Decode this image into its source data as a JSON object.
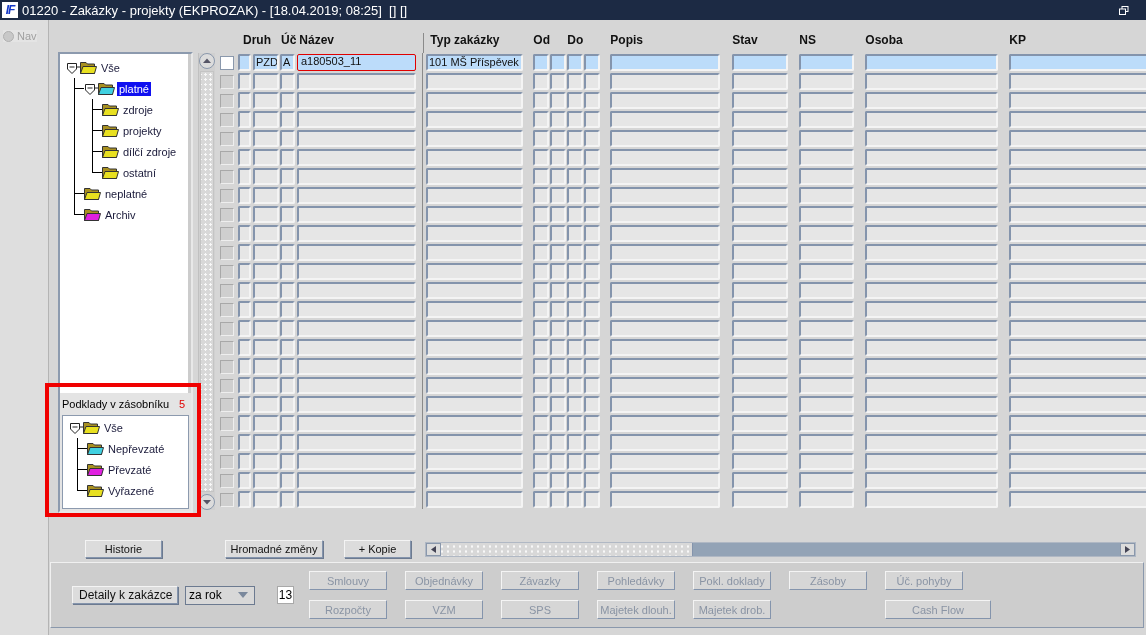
{
  "window": {
    "logo": "IF",
    "title": "01220 - Zakázky - projekty (EKPROZAK) - [18.04.2019; 08:25]  [] []"
  },
  "nav": {
    "label": "Nav",
    "disabled": true
  },
  "tree": [
    {
      "label": "Vše",
      "color": "#e8e020",
      "expanded": true,
      "selected": false,
      "children": [
        {
          "label": "platné",
          "color": "#40d0e0",
          "expanded": true,
          "selected": true,
          "children": [
            {
              "label": "zdroje",
              "color": "#e8e020",
              "selected": false
            },
            {
              "label": "projekty",
              "color": "#e8e020",
              "selected": false
            },
            {
              "label": "dílčí zdroje",
              "color": "#e8e020",
              "selected": false
            },
            {
              "label": "ostatní",
              "color": "#e8e020",
              "selected": false
            }
          ]
        },
        {
          "label": "neplatné",
          "color": "#e8e020",
          "selected": false
        },
        {
          "label": "Archiv",
          "color": "#e020e0",
          "selected": false
        }
      ]
    }
  ],
  "podklady": {
    "label": "Podklady v zásobníku",
    "count": "5",
    "highlighted": true,
    "tree": [
      {
        "label": "Vše",
        "color": "#e8e020",
        "expanded": true,
        "selected": false,
        "children": [
          {
            "label": "Nepřevzaté",
            "color": "#40d0e0",
            "selected": false
          },
          {
            "label": "Převzaté",
            "color": "#e020e0",
            "selected": false
          },
          {
            "label": "Vyřazené",
            "color": "#e8e020",
            "selected": false
          }
        ]
      }
    ]
  },
  "table": {
    "columns": [
      "Druh",
      "Úč",
      "Název",
      "Typ zakázky",
      "Od",
      "Do",
      "Popis",
      "Stav",
      "NS",
      "Osoba",
      "KP"
    ],
    "rows": [
      {
        "selected": true,
        "focused": true,
        "checked": false,
        "druh": "PZD",
        "uc": "A",
        "nazev": "a180503_11",
        "typ_zakazky": "101 MŠ Příspěvek"
      },
      {
        "selected": false,
        "focused": false,
        "checked": false
      },
      {
        "selected": false,
        "focused": false,
        "checked": false
      },
      {
        "selected": false,
        "focused": false,
        "checked": false
      },
      {
        "selected": false,
        "focused": false,
        "checked": false
      },
      {
        "selected": false,
        "focused": false,
        "checked": false
      },
      {
        "selected": false,
        "focused": false,
        "checked": false
      },
      {
        "selected": false,
        "focused": false,
        "checked": false
      },
      {
        "selected": false,
        "focused": false,
        "checked": false
      },
      {
        "selected": false,
        "focused": false,
        "checked": false
      },
      {
        "selected": false,
        "focused": false,
        "checked": false
      },
      {
        "selected": false,
        "focused": false,
        "checked": false
      },
      {
        "selected": false,
        "focused": false,
        "checked": false
      },
      {
        "selected": false,
        "focused": false,
        "checked": false
      },
      {
        "selected": false,
        "focused": false,
        "checked": false
      },
      {
        "selected": false,
        "focused": false,
        "checked": false
      },
      {
        "selected": false,
        "focused": false,
        "checked": false
      },
      {
        "selected": false,
        "focused": false,
        "checked": false
      },
      {
        "selected": false,
        "focused": false,
        "checked": false
      },
      {
        "selected": false,
        "focused": false,
        "checked": false
      },
      {
        "selected": false,
        "focused": false,
        "checked": false
      },
      {
        "selected": false,
        "focused": false,
        "checked": false
      },
      {
        "selected": false,
        "focused": false,
        "checked": false
      },
      {
        "selected": false,
        "focused": false,
        "checked": false
      }
    ]
  },
  "buttons": [
    "Historie",
    "Hromadné změny",
    "+ Kopie"
  ],
  "details": {
    "button": "Detaily k zakázce",
    "period": "za rok",
    "number": "13",
    "actions": [
      [
        {
          "kind": "button",
          "label": "Smlouvy",
          "disabled": true
        },
        {
          "kind": "button",
          "label": "Objednávky",
          "disabled": true
        },
        {
          "kind": "button",
          "label": "Závazky",
          "disabled": true
        },
        {
          "kind": "button",
          "label": "Pohledávky",
          "disabled": true
        },
        {
          "kind": "button",
          "label": "Pokl. doklady",
          "disabled": true
        },
        {
          "kind": "button",
          "label": "Zásoby",
          "disabled": true
        },
        {
          "kind": "button",
          "label": "Úč. pohyby",
          "disabled": true
        }
      ],
      [
        {
          "kind": "button",
          "label": "Rozpočty",
          "disabled": true
        },
        {
          "kind": "button",
          "label": "VZM",
          "disabled": true
        },
        {
          "kind": "button",
          "label": "SPS",
          "disabled": true
        },
        {
          "kind": "button",
          "label": "Majetek dlouh.",
          "disabled": true
        },
        {
          "kind": "button",
          "label": "Majetek drob.",
          "disabled": true
        },
        {
          "kind": "blank"
        },
        {
          "kind": "wide",
          "label": "Cash Flow",
          "disabled": true
        }
      ]
    ]
  }
}
